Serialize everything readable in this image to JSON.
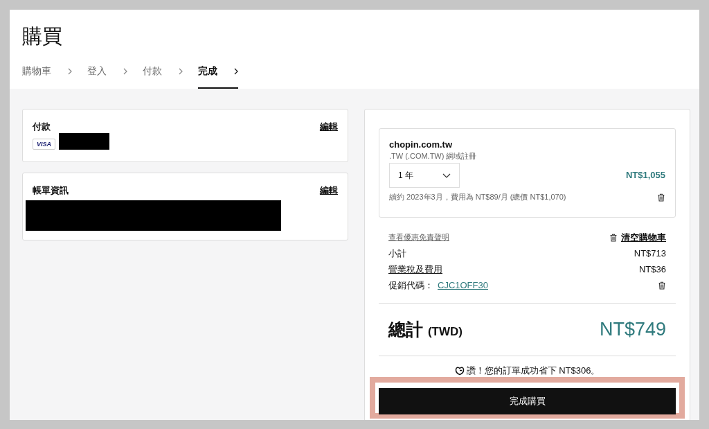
{
  "page": {
    "title": "購買"
  },
  "steps": [
    {
      "label": "購物車",
      "selected": false
    },
    {
      "label": "登入",
      "selected": false
    },
    {
      "label": "付款",
      "selected": false
    },
    {
      "label": "完成",
      "selected": true
    }
  ],
  "payment": {
    "title": "付款",
    "edit": "編輯",
    "card_brand": "VISA"
  },
  "billing": {
    "title": "帳單資訊",
    "edit": "編輯"
  },
  "cart_item": {
    "name": "chopin.com.tw",
    "product": ".TW (.COM.TW) 網域註冊",
    "term": "1 年",
    "price": "NT$1,055",
    "renewal": "續約 2023年3月，費用為 NT$89/月 (總價 NT$1,070)"
  },
  "summary": {
    "disclaimer_link": "查看優惠免責聲明",
    "clear_cart": "清空購物車",
    "subtotal_label": "小計",
    "subtotal": "NT$713",
    "tax_label": "營業稅及費用",
    "tax": "NT$36",
    "promo_label": "促銷代碼：",
    "promo_code": "CJC1OFF30"
  },
  "total": {
    "label": "總計",
    "currency": "(TWD)",
    "amount": "NT$749"
  },
  "savings": "讚！您的訂單成功省下 NT$306。",
  "checkout_button": "完成購買"
}
